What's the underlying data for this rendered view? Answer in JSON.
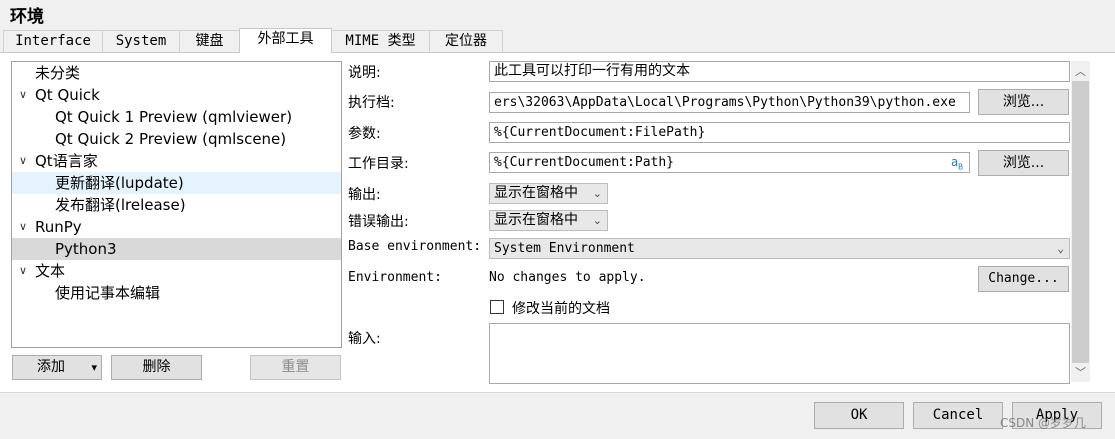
{
  "window": {
    "title": "环境"
  },
  "tabs": [
    {
      "label": "Interface"
    },
    {
      "label": "System"
    },
    {
      "label": "键盘"
    },
    {
      "label": "外部工具",
      "active": true
    },
    {
      "label": "MIME 类型"
    },
    {
      "label": "定位器"
    }
  ],
  "tree": [
    {
      "label": "未分类"
    },
    {
      "label": "Qt Quick",
      "expanded": true
    },
    {
      "label": "Qt Quick 1 Preview (qmlviewer)"
    },
    {
      "label": "Qt Quick 2 Preview (qmlscene)"
    },
    {
      "label": "Qt语言家",
      "expanded": true
    },
    {
      "label": "更新翻译(lupdate)",
      "state": "hover"
    },
    {
      "label": "发布翻译(lrelease)"
    },
    {
      "label": "RunPy",
      "expanded": true
    },
    {
      "label": "Python3",
      "state": "selected"
    },
    {
      "label": "文本",
      "expanded": true
    },
    {
      "label": "使用记事本编辑"
    }
  ],
  "tree_buttons": {
    "add": "添加",
    "add_arrow": "▾",
    "delete": "删除",
    "reset": "重置"
  },
  "form": {
    "description_label": "说明:",
    "description_value": "此工具可以打印一行有用的文本",
    "executable_label": "执行档:",
    "executable_value": "ers\\32063\\AppData\\Local\\Programs\\Python\\Python39\\python.exe",
    "browse": "浏览...",
    "arguments_label": "参数:",
    "arguments_value": "%{CurrentDocument:FilePath}",
    "workdir_label": "工作目录:",
    "workdir_value": "%{CurrentDocument:Path}",
    "workdir_icon_text": "a",
    "workdir_icon_sub": "B",
    "output_label": "输出:",
    "output_value": "显示在窗格中",
    "error_label": "错误输出:",
    "error_value": "显示在窗格中",
    "base_env_label": "Base environment:",
    "base_env_value": "System Environment",
    "env_label": "Environment:",
    "env_value": "No changes to apply.",
    "env_change": "Change...",
    "modify_doc_label": "修改当前的文档",
    "input_label": "输入:"
  },
  "icons": {
    "chevron_down": "⌄",
    "expanded_chevron": "∨",
    "scroll_up": "︿",
    "scroll_down": "﹀"
  },
  "footer": {
    "ok": "OK",
    "cancel": "Cancel",
    "apply": "Apply"
  },
  "watermark": "CSDN @岁岁几"
}
